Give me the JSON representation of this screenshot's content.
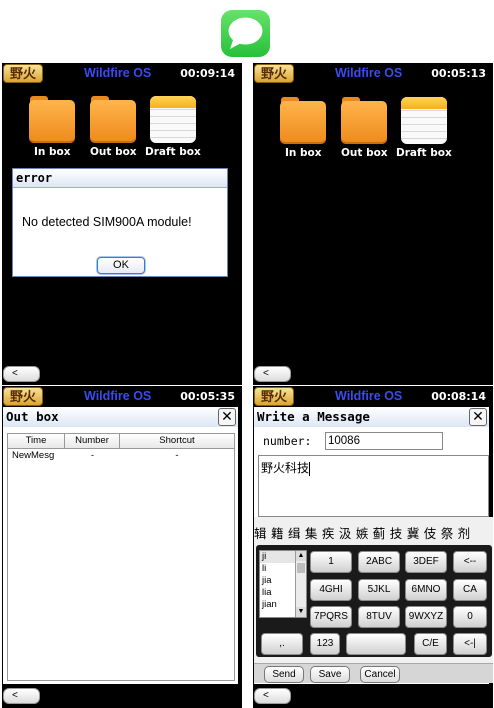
{
  "app_icon": "messages-app-icon",
  "status": {
    "logo": "野火",
    "os_title": "Wildfire OS"
  },
  "screens": [
    {
      "clock": "00:09:14"
    },
    {
      "clock": "00:05:13"
    },
    {
      "clock": "00:05:35"
    },
    {
      "clock": "00:08:14"
    }
  ],
  "home": {
    "inbox": "In box",
    "outbox": "Out box",
    "draftbox": "Draft box"
  },
  "error": {
    "title": "error",
    "message": "No detected SIM900A module!",
    "ok": "OK"
  },
  "back_label": "<",
  "outbox_window": {
    "title": "Out box",
    "close": "✕",
    "columns": [
      "Time",
      "Number",
      "Shortcut"
    ],
    "rows": [
      [
        "NewMesg",
        "-",
        "-"
      ]
    ]
  },
  "compose": {
    "title": "Write a Message",
    "close": "✕",
    "number_label": "number:",
    "number_value": "10086",
    "message_text": "野火科技",
    "candidates": "辑 籍 缉 集 疾 汲 嫉 蓟 技 冀 伎 祭 剂",
    "pinyin": [
      "ji",
      "li",
      "jia",
      "lia",
      "jian"
    ],
    "keys": {
      "k1": "1",
      "k2": "2ABC",
      "k3": "3DEF",
      "back": "<--",
      "k4": "4GHI",
      "k5": "5JKL",
      "k6": "6MNO",
      "ca": "CA",
      "k7": "7PQRS",
      "k8": "8TUV",
      "k9": "9WXYZ",
      "k0": "0",
      "punct": ",.",
      "num": "123",
      "space": "",
      "ce": "C/E",
      "enter": "<-|"
    },
    "send": "Send",
    "save": "Save",
    "cancel": "Cancel"
  }
}
